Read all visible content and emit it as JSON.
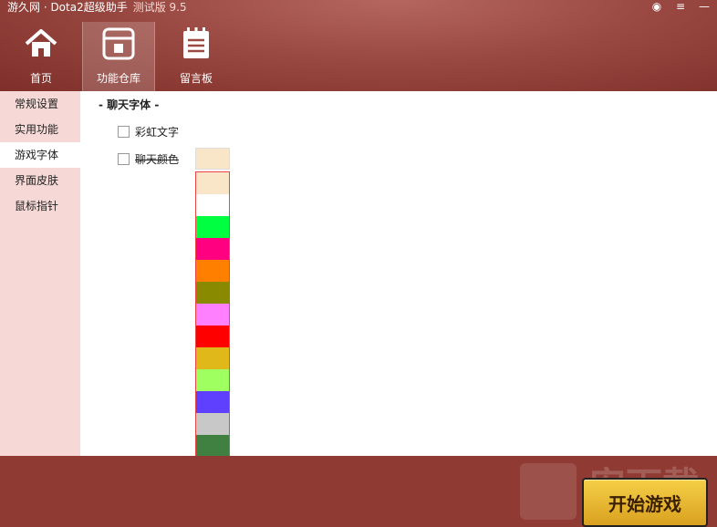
{
  "title": {
    "main": "游久网 · Dota2超级助手",
    "sub": "测试版 9.5"
  },
  "window_controls": [
    "globe-icon",
    "menu-icon",
    "minimize-icon"
  ],
  "nav": [
    {
      "label": "首页",
      "icon": "home-icon"
    },
    {
      "label": "功能仓库",
      "icon": "box-icon",
      "active": true
    },
    {
      "label": "留言板",
      "icon": "notepad-icon"
    }
  ],
  "sidebar": {
    "items": [
      {
        "label": "常规设置"
      },
      {
        "label": "实用功能"
      },
      {
        "label": "游戏字体",
        "active": true
      },
      {
        "label": "界面皮肤"
      },
      {
        "label": "鼠标指针"
      }
    ]
  },
  "content": {
    "section_title": "- 聊天字体 -",
    "options": [
      {
        "label": "彩虹文字",
        "checked": false
      },
      {
        "label": "聊天颜色",
        "checked": false
      }
    ],
    "selected_color": "#f9e6c8",
    "color_options": [
      "#f9e6c8",
      "#ffffff",
      "#00ff40",
      "#ff0080",
      "#ff8000",
      "#8a8a00",
      "#ff80ff",
      "#ff0000",
      "#e0b81a",
      "#a0ff60",
      "#6040ff",
      "#c8c8c8",
      "#408040",
      "#0080ff",
      "#800080",
      "#ff4040"
    ]
  },
  "footer": {
    "start_label": "开始游戏",
    "watermark": "安下载"
  }
}
